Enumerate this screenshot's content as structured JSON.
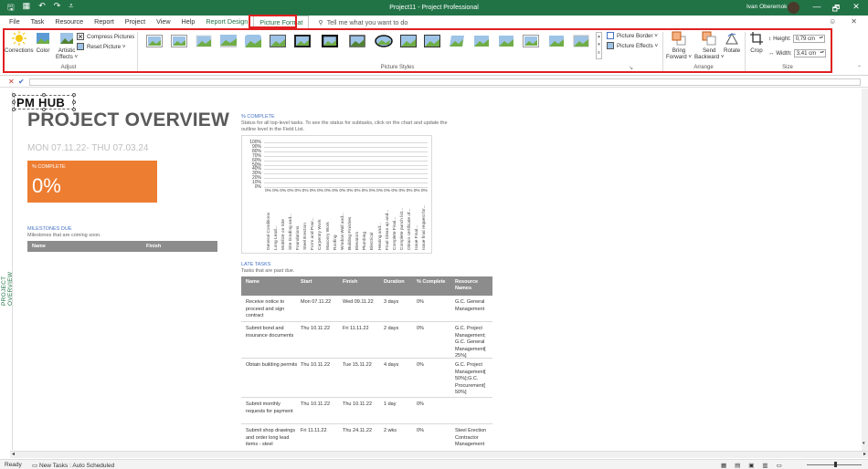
{
  "titlebar": {
    "title": "Project11 - Project Professional",
    "user": "Ivan Oberemok",
    "minimize": "—",
    "restore": "🗗",
    "close": "✕"
  },
  "menu": {
    "tabs": [
      "File",
      "Task",
      "Resource",
      "Report",
      "Project",
      "View",
      "Help",
      "Report Design",
      "Picture Format"
    ],
    "tell_me": "Tell me what you want to do"
  },
  "ribbon": {
    "adjust": {
      "corrections": "Corrections",
      "color": "Color",
      "artistic": "Artistic",
      "effects": "Effects ˅",
      "compress": "Compress Pictures",
      "reset": "Reset Picture  ˅",
      "label": "Adjust"
    },
    "styles": {
      "label": "Picture Styles",
      "border": "Picture Border ˅",
      "effects": "Picture Effects ˅"
    },
    "arrange": {
      "bring": "Bring",
      "forward": "Forward ˅",
      "send": "Send",
      "backward": "Backward ˅",
      "rotate": "Rotate",
      "label": "Arrange"
    },
    "size": {
      "crop": "Crop",
      "height_label": "Height:",
      "height": "0,79 cm",
      "width_label": "Width:",
      "width": "3,41 cm",
      "label": "Size"
    }
  },
  "formula": {
    "cancel": "✕",
    "confirm": "✔"
  },
  "report": {
    "logo": "PM HUB",
    "title": "PROJECT OVERVIEW",
    "dates": "MON 07.11.22-  THU 07.03.24",
    "pct_label": "% COMPLETE",
    "pct_value": "0%",
    "side_label": "PROJECT OVERVIEW",
    "milestones": {
      "title": "MILESTONES DUE",
      "subtitle": "Milestones that are coming soon.",
      "col_name": "Name",
      "col_finish": "Finish"
    },
    "pct_section": {
      "title": "% COMPLETE",
      "line1": "Status for all top-level tasks. To see the status for subtasks, click on the chart and update the",
      "line2": "outline level in the Field List."
    },
    "late": {
      "title": "LATE TASKS",
      "subtitle": "Tasks that are past due.",
      "headers": {
        "name": "Name",
        "start": "Start",
        "finish": "Finish",
        "duration": "Duration",
        "pct": "% Complete",
        "resources": "Resource Names"
      },
      "rows": [
        {
          "name": "Receive notice to proceed and sign contract",
          "start": "Mon 07.11.22",
          "finish": "Wed 09.11.22",
          "duration": "3 days",
          "pct": "0%",
          "resources": "G.C. General Management"
        },
        {
          "name": "Submit bond and insurance documents",
          "start": "Thu 10.11.22",
          "finish": "Fri 11.11.22",
          "duration": "2 days",
          "pct": "0%",
          "resources": "G.C. Project Management; G.C. General Management[ 25%]"
        },
        {
          "name": "Obtain building permits",
          "start": "Thu 10.11.22",
          "finish": "Tue 15.11.22",
          "duration": "4 days",
          "pct": "0%",
          "resources": "G.C. Project Management[ 50%];G.C. Procurement[ 50%]"
        },
        {
          "name": "Submit monthly requests for payment",
          "start": "Thu 10.11.22",
          "finish": "Thu 10.11.22",
          "duration": "1 day",
          "pct": "0%",
          "resources": ""
        },
        {
          "name": "Submit shop drawings and order long lead items - steel",
          "start": "Fri 11.11.22",
          "finish": "Thu 24.11.22",
          "duration": "2 wks",
          "pct": "0%",
          "resources": "Steel Erection Contractor Management"
        }
      ]
    }
  },
  "chart_data": {
    "type": "bar",
    "y_ticks": [
      "100%",
      "90%",
      "80%",
      "70%",
      "60%",
      "50%",
      "40%",
      "30%",
      "20%",
      "10%",
      "0%"
    ],
    "ylim": [
      0,
      100
    ],
    "categories": [
      "General Conditions",
      "Long Lead...",
      "Mobilize on Site",
      "Site Grading and...",
      "Foundations",
      "Steel Erection",
      "Form and Pour...",
      "Carpentry Work",
      "Masonry Work",
      "Roofing",
      "Window Wall and...",
      "Building Finishes",
      "Elevators",
      "Plumbing",
      "Electrical",
      "Heating and...",
      "Final Clean up and...",
      "Complete Final...",
      "Complete punch list...",
      "Obtain certificate of...",
      "Issue Final...",
      "Issue final request for..."
    ],
    "values": [
      0,
      0,
      0,
      0,
      0,
      0,
      0,
      0,
      0,
      0,
      0,
      0,
      0,
      0,
      0,
      0,
      0,
      0,
      0,
      0,
      0,
      0
    ],
    "labels": [
      "0%",
      "0%",
      "0%",
      "0%",
      "0%",
      "0%",
      "0%",
      "0%",
      "0%",
      "0%",
      "0%",
      "0%",
      "0%",
      "0%",
      "0%",
      "0%",
      "0%",
      "0%",
      "0%",
      "0%",
      "0%",
      "0%"
    ]
  },
  "status": {
    "ready": "Ready",
    "new_tasks": "New Tasks : Auto Scheduled"
  },
  "colors": {
    "accent": "#217346",
    "orange": "#ed7d31",
    "link_blue": "#4472c4",
    "highlight": "#e02020"
  }
}
